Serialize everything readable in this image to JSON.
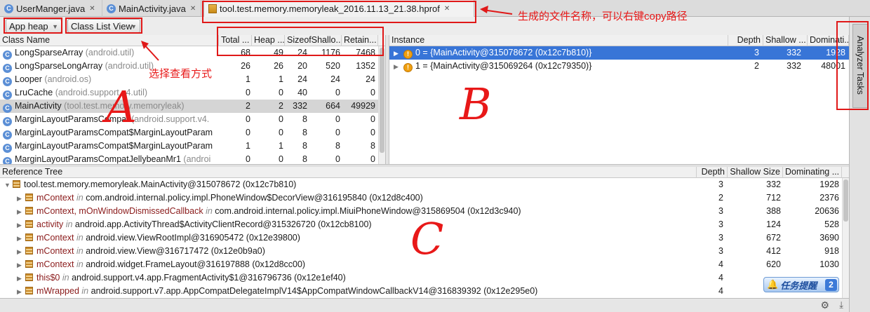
{
  "tabs": [
    {
      "label": "UserManger.java",
      "icon": "c"
    },
    {
      "label": "MainActivity.java",
      "icon": "c"
    },
    {
      "label": "tool.test.memory.memoryleak_2016.11.13_21.38.hprof",
      "icon": "hprof"
    }
  ],
  "toolbar": {
    "heap_select": "App heap",
    "view_select": "Class List View"
  },
  "class_list": {
    "columns": [
      "Class Name",
      "Total ...",
      "Heap ...",
      "SizeofShallo...",
      "Retain..."
    ],
    "rows": [
      {
        "name": "LongSparseArray",
        "pkg": "(android.util)",
        "total": "68",
        "heap": "49",
        "size": "24",
        "shallow": "1176",
        "retained": "7468"
      },
      {
        "name": "LongSparseLongArray",
        "pkg": "(android.util)",
        "total": "26",
        "heap": "26",
        "size": "20",
        "shallow": "520",
        "retained": "1352"
      },
      {
        "name": "Looper",
        "pkg": "(android.os)",
        "total": "1",
        "heap": "1",
        "size": "24",
        "shallow": "24",
        "retained": "24"
      },
      {
        "name": "LruCache",
        "pkg": "(android.support.v4.util)",
        "total": "0",
        "heap": "0",
        "size": "40",
        "shallow": "0",
        "retained": "0"
      },
      {
        "name": "MainActivity",
        "pkg": "(tool.test.memory.memoryleak)",
        "total": "2",
        "heap": "2",
        "size": "332",
        "shallow": "664",
        "retained": "49929"
      },
      {
        "name": "MarginLayoutParamsCompat",
        "pkg": "(android.support.v4.",
        "total": "0",
        "heap": "0",
        "size": "8",
        "shallow": "0",
        "retained": "0"
      },
      {
        "name": "MarginLayoutParamsCompat$MarginLayoutParam",
        "pkg": "",
        "total": "0",
        "heap": "0",
        "size": "8",
        "shallow": "0",
        "retained": "0"
      },
      {
        "name": "MarginLayoutParamsCompat$MarginLayoutParam",
        "pkg": "",
        "total": "1",
        "heap": "1",
        "size": "8",
        "shallow": "8",
        "retained": "8"
      },
      {
        "name": "MarginLayoutParamsCompatJellybeanMr1",
        "pkg": "(androi",
        "total": "0",
        "heap": "0",
        "size": "8",
        "shallow": "0",
        "retained": "0"
      }
    ]
  },
  "instance": {
    "columns": [
      "Instance",
      "Depth",
      "Shallow ...",
      "Dominati..."
    ],
    "rows": [
      {
        "label": "0 = {MainActivity@315078672 (0x12c7b810)}",
        "depth": "3",
        "shallow": "332",
        "dominating": "1928"
      },
      {
        "label": "1 = {MainActivity@315069264 (0x12c79350)}",
        "depth": "2",
        "shallow": "332",
        "dominating": "48001"
      }
    ]
  },
  "reference_tree": {
    "columns": [
      "Reference Tree",
      "Depth",
      "Shallow Size",
      "Dominating ..."
    ],
    "root": {
      "label": "tool.test.memory.memoryleak.MainActivity@315078672 (0x12c7b810)",
      "depth": "3",
      "shallow": "332",
      "dominating": "1928"
    },
    "rows": [
      {
        "field": "mContext",
        "in": "in",
        "target": "com.android.internal.policy.impl.PhoneWindow$DecorView@316195840 (0x12d8c400)",
        "depth": "2",
        "shallow": "712",
        "dominating": "2376"
      },
      {
        "field": "mContext, mOnWindowDismissedCallback",
        "in": "in",
        "target": "com.android.internal.policy.impl.MiuiPhoneWindow@315869504 (0x12d3c940)",
        "depth": "3",
        "shallow": "388",
        "dominating": "20636"
      },
      {
        "field": "activity",
        "in": "in",
        "target": "android.app.ActivityThread$ActivityClientRecord@315326720 (0x12cb8100)",
        "depth": "3",
        "shallow": "124",
        "dominating": "528"
      },
      {
        "field": "mContext",
        "in": "in",
        "target": "android.view.ViewRootImpl@316905472 (0x12e39800)",
        "depth": "3",
        "shallow": "672",
        "dominating": "3690"
      },
      {
        "field": "mContext",
        "in": "in",
        "target": "android.view.View@316717472 (0x12e0b9a0)",
        "depth": "3",
        "shallow": "412",
        "dominating": "918"
      },
      {
        "field": "mContext",
        "in": "in",
        "target": "android.widget.FrameLayout@316197888 (0x12d8cc00)",
        "depth": "4",
        "shallow": "620",
        "dominating": "1030"
      },
      {
        "field": "this$0",
        "in": "in",
        "target": "android.support.v4.app.FragmentActivity$1@316796736 (0x12e1ef40)",
        "depth": "4",
        "shallow": "",
        "dominating": ""
      },
      {
        "field": "mWrapped",
        "in": "in",
        "target": "android.support.v7.app.AppCompatDelegateImplV14$AppCompatWindowCallbackV14@316839392 (0x12e295e0)",
        "depth": "4",
        "shallow": "",
        "dominating": ""
      }
    ]
  },
  "side_panel": {
    "label": "Analyzer Tasks"
  },
  "annotations": {
    "file_name_note": "生成的文件名称，可以右键copy路径",
    "view_mode_note": "选择查看方式",
    "letter_a": "A",
    "letter_b": "B",
    "letter_c": "C"
  },
  "notification": {
    "text": "任务提醒",
    "count": "2"
  },
  "colors": {
    "selection_blue": "#3875d7",
    "annotation_red": "#e01818",
    "row_selected_gray": "#d5d5d5"
  }
}
